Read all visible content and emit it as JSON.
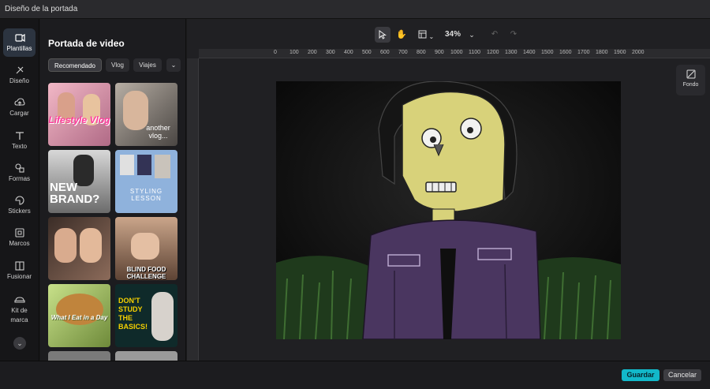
{
  "window": {
    "title": "Diseño de la portada"
  },
  "rail": {
    "items": [
      {
        "label": "Plantillas",
        "icon": "template-icon"
      },
      {
        "label": "Diseño",
        "icon": "design-icon"
      },
      {
        "label": "Cargar",
        "icon": "upload-icon"
      },
      {
        "label": "Texto",
        "icon": "text-icon"
      },
      {
        "label": "Formas",
        "icon": "shapes-icon"
      },
      {
        "label": "Stickers",
        "icon": "sticker-icon"
      },
      {
        "label": "Marcos",
        "icon": "frame-icon"
      },
      {
        "label": "Fusionar",
        "icon": "merge-icon"
      },
      {
        "label": "Kit de marca",
        "icon": "brand-kit-icon"
      }
    ]
  },
  "panel": {
    "title": "Portada de video",
    "chips": [
      "Recomendado",
      "Vlog",
      "Viajes"
    ],
    "thumbs": [
      {
        "text": "Lifestyle Vlog"
      },
      {
        "text": "another vlog..."
      },
      {
        "text": "NEW BRAND?"
      },
      {
        "text": "STYLING LESSON"
      },
      {
        "text": ""
      },
      {
        "text": "BLIND FOOD CHALLENGE"
      },
      {
        "text": "What I Eat in a Day"
      },
      {
        "text": "DON'T STUDY THE BASICS!"
      }
    ]
  },
  "toolbar": {
    "zoom": "34%"
  },
  "ruler": {
    "marks": [
      "0",
      "100",
      "200",
      "300",
      "400",
      "500",
      "600",
      "700",
      "800",
      "900",
      "1000",
      "1100",
      "1200",
      "1300",
      "1400",
      "1500",
      "1600",
      "1700",
      "1800",
      "1900",
      "2000"
    ]
  },
  "side": {
    "fondo": "Fondo"
  },
  "footer": {
    "save": "Guardar",
    "cancel": "Cancelar"
  },
  "colors": {
    "accent": "#12b8c9",
    "panel": "#1c1c1f",
    "canvas_bg": "#202023"
  }
}
